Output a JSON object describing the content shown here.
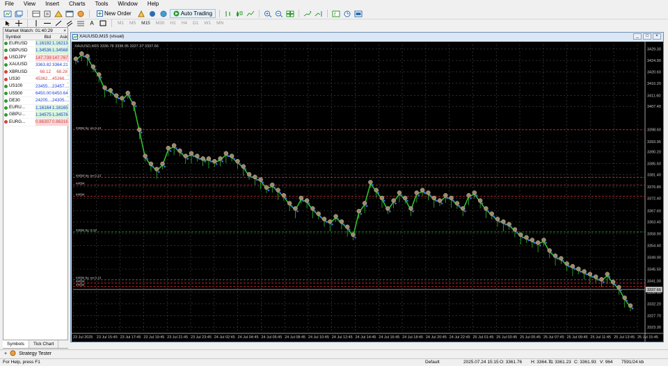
{
  "menu": [
    "File",
    "View",
    "Insert",
    "Charts",
    "Tools",
    "Window",
    "Help"
  ],
  "toolbar": {
    "new_order_label": "New Order",
    "auto_trading_label": "Auto Trading"
  },
  "timeframes": [
    "M1",
    "M5",
    "M15",
    "M30",
    "H1",
    "H4",
    "D1",
    "W1",
    "MN"
  ],
  "active_timeframe": "M15",
  "market_watch": {
    "title": "Market Watch: 01:40:29",
    "col_symbol": "Symbol",
    "col_bid": "Bid",
    "col_ask": "Ask",
    "rows": [
      {
        "symbol": "EURUSD",
        "bid": "1.16192",
        "ask": "1.16213",
        "color": "#2e9a2e",
        "bg": "#d8f5d8"
      },
      {
        "symbol": "GBPUSD",
        "bid": "1.34536",
        "ask": "1.34568",
        "color": "#2e9a2e",
        "bg": "#d8f5d8"
      },
      {
        "symbol": "USDJPY",
        "bid": "147.739",
        "ask": "147.767",
        "color": "#d04040",
        "bg": "#fbd6d6"
      },
      {
        "symbol": "XAUUSD",
        "bid": "3363.82",
        "ask": "3364.21",
        "color": "#2e9a2e",
        "bg": "#ffffff"
      },
      {
        "symbol": "XBRUSD",
        "bid": "68.12",
        "ask": "68.28",
        "color": "#d04040",
        "bg": "#ffffff"
      },
      {
        "symbol": "US30",
        "bid": "45362....",
        "ask": "45366....",
        "color": "#d04040",
        "bg": "#ffffff"
      },
      {
        "symbol": "US100",
        "bid": "23455....",
        "ask": "23457....",
        "color": "#2e9a2e",
        "bg": "#ffffff"
      },
      {
        "symbol": "US500",
        "bid": "6450.00",
        "ask": "6450.64",
        "color": "#2e9a2e",
        "bg": "#ffffff"
      },
      {
        "symbol": "DE30",
        "bid": "24205....",
        "ask": "24305....",
        "color": "#2e9a2e",
        "bg": "#ffffff"
      },
      {
        "symbol": "EURU...",
        "bid": "1.16164",
        "ask": "1.16165",
        "color": "#2e9a2e",
        "bg": "#d8f5d8"
      },
      {
        "symbol": "GBPU...",
        "bid": "1.34575",
        "ask": "1.34576",
        "color": "#2e9a2e",
        "bg": "#d8f5d8"
      },
      {
        "symbol": "EURG...",
        "bid": "0.86307",
        "ask": "0.86316",
        "color": "#d04040",
        "bg": "#fbd6d6"
      }
    ],
    "tabs": [
      "Symbols",
      "Tick Chart"
    ]
  },
  "chart_window": {
    "title": "XAUUSD,M15 (visual)",
    "ohlc_header": "XAUUSD,M15 3336.78 3338.95 3327.37 3337.66"
  },
  "chart_data": {
    "type": "line",
    "symbol": "XAUUSD",
    "timeframe": "M15",
    "y_ticks": [
      "3429.30",
      "3424.90",
      "3420.60",
      "3416.20",
      "3411.60",
      "3407.40",
      "3398.60",
      "3393.95",
      "3390.20",
      "3385.60",
      "3381.40",
      "3376.80",
      "3372.40",
      "3367.60",
      "3363.40",
      "3358.90",
      "3354.40",
      "3349.90",
      "3345.50",
      "3341.00",
      "3336.60",
      "3332.20",
      "3327.70",
      "3323.30"
    ],
    "ylim": [
      3321.5,
      3431.0
    ],
    "x_ticks": [
      "23 Jul 2025",
      "23 Jul 15:45",
      "23 Jul 17:45",
      "23 Jul 19:45",
      "23 Jul 21:45",
      "23 Jul 23:45",
      "24 Jul 02:45",
      "24 Jul 04:45",
      "24 Jul 06:45",
      "24 Jul 08:45",
      "24 Jul 10:45",
      "24 Jul 12:45",
      "24 Jul 14:45",
      "24 Jul 16:45",
      "24 Jul 18:45",
      "24 Jul 20:45",
      "24 Jul 22:45",
      "25 Jul 01:45",
      "25 Jul 03:45",
      "25 Jul 05:45",
      "25 Jul 07:45",
      "25 Jul 09:45",
      "25 Jul 11:45",
      "25 Jul 13:45",
      "25 Jul 15:45"
    ],
    "current_price": "3337.66",
    "price_series": [
      3425,
      3427,
      3426,
      3422,
      3419,
      3414,
      3413,
      3411,
      3410,
      3412,
      3408,
      3398,
      3388,
      3385,
      3383,
      3385,
      3391,
      3392,
      3390,
      3388,
      3389,
      3388,
      3387,
      3387,
      3386,
      3387,
      3389,
      3388,
      3386,
      3384,
      3381,
      3380,
      3379,
      3376,
      3377,
      3375,
      3373,
      3370,
      3368,
      3372,
      3371,
      3368,
      3366,
      3364,
      3363,
      3365,
      3363,
      3361,
      3358,
      3367,
      3370,
      3378,
      3375,
      3372,
      3368,
      3371,
      3374,
      3372,
      3368,
      3374,
      3375,
      3374,
      3372,
      3371,
      3373,
      3372,
      3370,
      3368,
      3373,
      3374,
      3371,
      3368,
      3366,
      3364,
      3363,
      3362,
      3360,
      3358,
      3357,
      3356,
      3355,
      3356,
      3352,
      3350,
      3349,
      3347,
      3346,
      3345,
      3344,
      3343,
      3342,
      3341,
      3343,
      3340,
      3338,
      3334,
      3331
    ],
    "levels": [
      {
        "price": 3398.5,
        "color": "#e03030",
        "label": "#4094 by: en 0.13"
      },
      {
        "price": 3380.4,
        "color": "#e03030",
        "label": "#4094 by: en 0.13"
      },
      {
        "price": 3377.4,
        "color": "#e03030",
        "label": "#4094"
      },
      {
        "price": 3373.2,
        "color": "#e03030",
        "label": "#4094"
      },
      {
        "price": 3359.6,
        "color": "#30a030",
        "label": "#4094 by: 0.13"
      },
      {
        "price": 3341.5,
        "color": "#e03030",
        "label": "#4094 by: en 0.13"
      },
      {
        "price": 3340.1,
        "color": "#e03030",
        "label": "#4094"
      },
      {
        "price": 3338.8,
        "color": "#e03030",
        "label": "#4094"
      },
      {
        "price": 3337.66,
        "color": "#c0c0c0",
        "label": ""
      }
    ],
    "grid": true
  },
  "bottom_bar": {
    "strategy_tester_label": "Strategy Tester"
  },
  "status_bar": {
    "help": "For Help, press F1",
    "profile": "Default",
    "datetime": "2025.07.24 15:15",
    "open": "O: 3361.76",
    "high": "H: 3364.71",
    "low": "L: 3361.23",
    "close": "C: 3361.93",
    "volume": "V: 964",
    "traffic": "7591/24 kb"
  },
  "icons": [
    "new-chart-icon",
    "profiles-icon",
    "market-watch-icon",
    "navigator-icon",
    "terminal-icon",
    "tester-icon",
    "autotrading-icon",
    "zoom-in-icon",
    "zoom-out-icon",
    "tile-icon",
    "autoscroll-icon",
    "chart-shift-icon",
    "indicators-icon",
    "periods-icon",
    "templates-icon"
  ]
}
